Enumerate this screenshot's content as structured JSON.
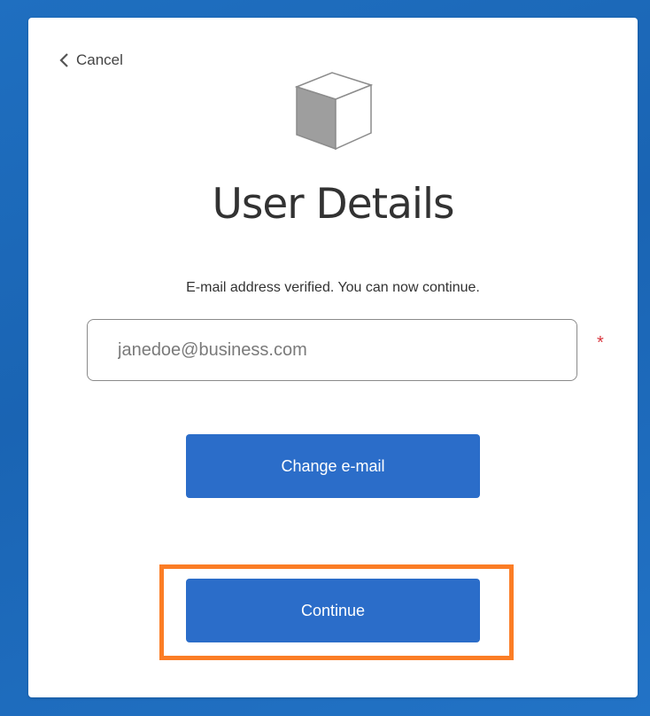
{
  "cancel": {
    "label": "Cancel",
    "icon": "chevron-left-icon"
  },
  "logo": {
    "icon": "cube-icon"
  },
  "page": {
    "title": "User Details"
  },
  "message": {
    "text": "E-mail address verified. You can now continue."
  },
  "email": {
    "placeholder": "janedoe@business.com",
    "value": "",
    "required_mark": "*"
  },
  "buttons": {
    "change_email": "Change e-mail",
    "continue": "Continue"
  },
  "colors": {
    "primary": "#2b6dc9",
    "highlight": "#fb7d25",
    "required": "#d9363e",
    "background": "#1f6fc0"
  }
}
